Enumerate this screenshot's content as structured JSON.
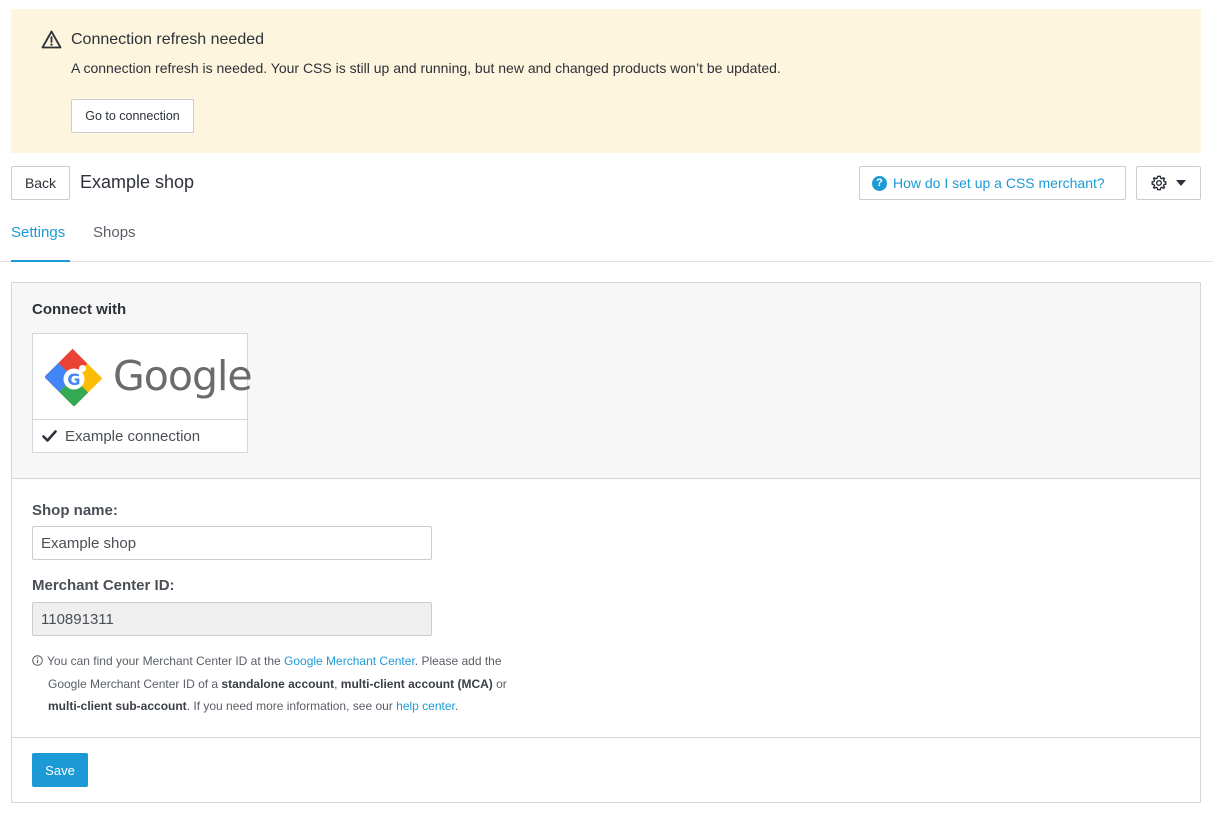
{
  "alert": {
    "title": "Connection refresh needed",
    "message": "A connection refresh is needed. Your CSS is still up and running, but new and changed products won’t be updated.",
    "button_label": "Go to connection",
    "background": "#fdf5dd"
  },
  "header": {
    "back_label": "Back",
    "title": "Example shop",
    "help_label": "How do I set up a CSS merchant?"
  },
  "tabs": [
    {
      "label": "Settings",
      "active": true
    },
    {
      "label": "Shops",
      "active": false
    }
  ],
  "connect": {
    "label": "Connect with",
    "provider_name": "Google",
    "connection_name": "Example connection"
  },
  "form": {
    "shop_name_label": "Shop name:",
    "shop_name_value": "Example shop",
    "merchant_id_label": "Merchant Center ID:",
    "merchant_id_value": "110891311",
    "hint": {
      "p1": "You can find your Merchant Center ID at the ",
      "link1": "Google Merchant Center",
      "p2": ". Please add the",
      "p3": "Google Merchant Center ID of a ",
      "b1": "standalone account",
      "p4": ", ",
      "b2": "multi-client account (MCA)",
      "p5": " or",
      "b3": "multi-client sub-account",
      "p6": ". If you need more information, see our ",
      "link2": "help center",
      "p7": "."
    }
  },
  "footer": {
    "save_label": "Save"
  },
  "colors": {
    "accent": "#1c9ad6",
    "border": "#d3d6db"
  }
}
